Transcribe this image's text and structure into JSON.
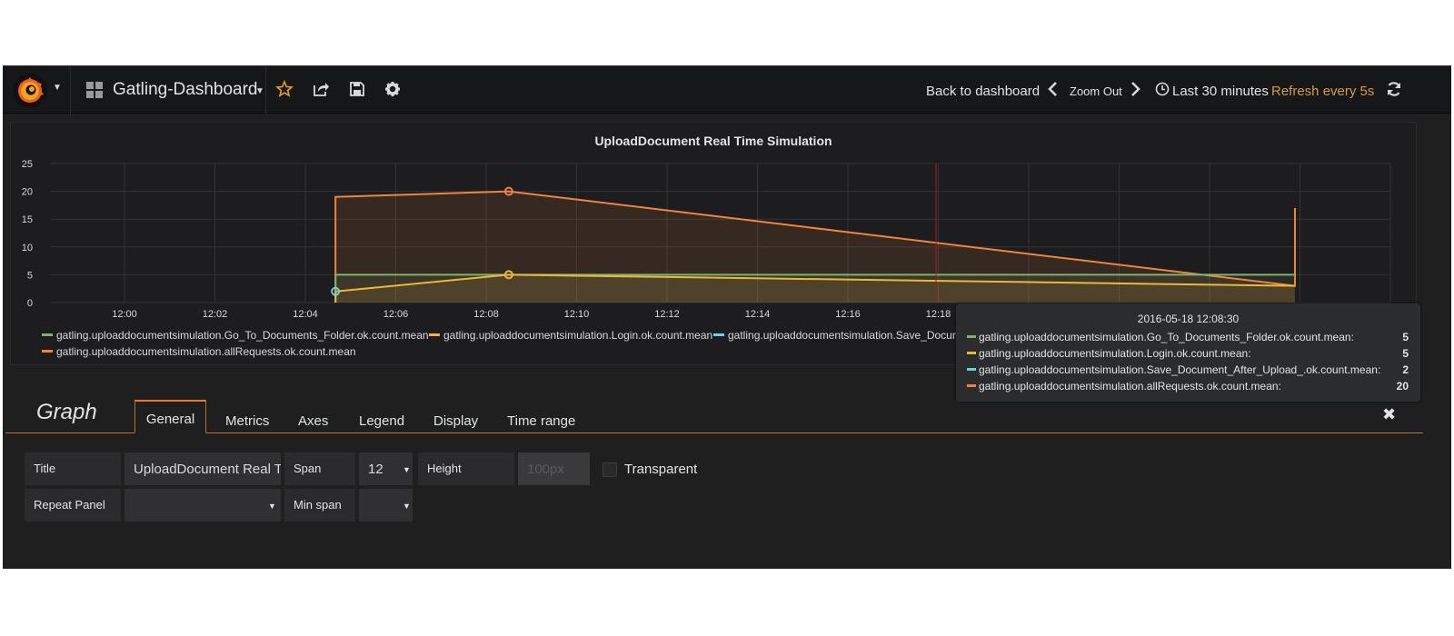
{
  "navbar": {
    "dashboard_title": "Gatling-Dashboard",
    "back_label": "Back to dashboard",
    "zoom_out_label": "Zoom Out",
    "time_range_label": "Last 30 minutes",
    "refresh_label": "Refresh every 5s"
  },
  "panel": {
    "title": "UploadDocument Real Time Simulation"
  },
  "legend": [
    {
      "label": "gatling.uploaddocumentsimulation.Go_To_Documents_Folder.ok.count.mean",
      "color": "#7eb26d"
    },
    {
      "label": "gatling.uploaddocumentsimulation.Login.ok.count.mean",
      "color": "#eab839"
    },
    {
      "label": "gatling.uploaddocumentsimulation.Save_Docume",
      "color": "#6ed0e0"
    },
    {
      "label": "gatling.uploaddocumentsimulation.allRequests.ok.count.mean",
      "color": "#ef843c"
    }
  ],
  "tooltip": {
    "time": "2016-05-18 12:08:30",
    "rows": [
      {
        "label": "gatling.uploaddocumentsimulation.Go_To_Documents_Folder.ok.count.mean:",
        "value": "5",
        "color": "#7eb26d"
      },
      {
        "label": "gatling.uploaddocumentsimulation.Login.ok.count.mean:",
        "value": "5",
        "color": "#eab839"
      },
      {
        "label": "gatling.uploaddocumentsimulation.Save_Document_After_Upload_.ok.count.mean:",
        "value": "2",
        "color": "#6ed0e0"
      },
      {
        "label": "gatling.uploaddocumentsimulation.allRequests.ok.count.mean:",
        "value": "20",
        "color": "#ef843c"
      }
    ]
  },
  "editor": {
    "title": "Graph",
    "tabs": [
      "General",
      "Metrics",
      "Axes",
      "Legend",
      "Display",
      "Time range"
    ],
    "fields": {
      "title_label": "Title",
      "title_value": "UploadDocument Real T",
      "span_label": "Span",
      "span_value": "12",
      "height_label": "Height",
      "height_placeholder": "100px",
      "transparent_label": "Transparent",
      "repeat_label": "Repeat Panel",
      "repeat_value": "",
      "minspan_label": "Min span",
      "minspan_value": ""
    }
  },
  "chart_data": {
    "type": "line",
    "title": "UploadDocument Real Time Simulation",
    "x_ticks": [
      "12:00",
      "12:02",
      "12:04",
      "12:06",
      "12:08",
      "12:10",
      "12:12",
      "12:14",
      "12:16",
      "12:18"
    ],
    "y_ticks": [
      "0",
      "5",
      "10",
      "15",
      "20",
      "25"
    ],
    "ylim": [
      0,
      25
    ],
    "grid": true,
    "legend_position": "bottom",
    "series": [
      {
        "name": "gatling.uploaddocumentsimulation.Go_To_Documents_Folder.ok.count.mean",
        "color": "#7eb26d",
        "points": [
          [
            "12:04:40",
            5
          ],
          [
            "12:08:30",
            5
          ],
          [
            "12:30:00",
            5
          ]
        ]
      },
      {
        "name": "gatling.uploaddocumentsimulation.Login.ok.count.mean",
        "color": "#eab839",
        "points": [
          [
            "12:04:40",
            2
          ],
          [
            "12:08:30",
            5
          ],
          [
            "12:30:00",
            3
          ]
        ]
      },
      {
        "name": "gatling.uploaddocumentsimulation.Save_Document_After_Upload_.ok.count.mean",
        "color": "#6ed0e0",
        "points": [
          [
            "12:04:40",
            2
          ]
        ]
      },
      {
        "name": "gatling.uploaddocumentsimulation.allRequests.ok.count.mean",
        "color": "#ef843c",
        "points": [
          [
            "12:04:40",
            19
          ],
          [
            "12:08:30",
            20
          ],
          [
            "12:30:00",
            3
          ],
          [
            "12:30:00",
            17
          ]
        ]
      }
    ],
    "hover_time": "12:08:30"
  }
}
